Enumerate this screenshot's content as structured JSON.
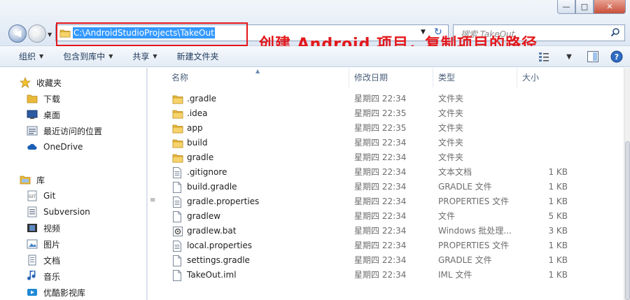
{
  "window": {
    "minimize_glyph": "—",
    "maximize_glyph": "□",
    "close_glyph": "✕"
  },
  "address": {
    "path": "C:\\AndroidStudioProjects\\TakeOut",
    "dropdown_glyph": "▼",
    "refresh_glyph": "↻"
  },
  "search": {
    "placeholder": "搜索 TakeOut"
  },
  "annotation": {
    "text": "创建 Android 项目，复制项目的路径",
    "color": "#e3171b"
  },
  "toolbar": {
    "organize": "组织",
    "include_in_library": "包含到库中",
    "share": "共享",
    "new_folder": "新建文件夹",
    "caret": "▼"
  },
  "sidebar": {
    "favorites_label": "收藏夹",
    "favorites": [
      {
        "label": "下载",
        "icon": "folder-icon"
      },
      {
        "label": "桌面",
        "icon": "desktop-icon"
      },
      {
        "label": "最近访问的位置",
        "icon": "recent-places-icon"
      },
      {
        "label": "OneDrive",
        "icon": "cloud-icon"
      }
    ],
    "library_label": "库",
    "libraries": [
      {
        "label": "Git",
        "icon": "git-library-icon"
      },
      {
        "label": "Subversion",
        "icon": "svn-library-icon"
      },
      {
        "label": "视频",
        "icon": "video-icon"
      },
      {
        "label": "图片",
        "icon": "pictures-icon"
      },
      {
        "label": "文档",
        "icon": "documents-icon"
      },
      {
        "label": "音乐",
        "icon": "music-icon"
      },
      {
        "label": "优酷影视库",
        "icon": "youku-library-icon"
      }
    ]
  },
  "columns": {
    "name": "名称",
    "modified": "修改日期",
    "type": "类型",
    "size": "大小"
  },
  "files": [
    {
      "name": ".gradle",
      "date": "星期四 22:34",
      "type": "文件夹",
      "size": "",
      "icon": "folder"
    },
    {
      "name": ".idea",
      "date": "星期四 22:35",
      "type": "文件夹",
      "size": "",
      "icon": "folder"
    },
    {
      "name": "app",
      "date": "星期四 22:35",
      "type": "文件夹",
      "size": "",
      "icon": "folder"
    },
    {
      "name": "build",
      "date": "星期四 22:34",
      "type": "文件夹",
      "size": "",
      "icon": "folder"
    },
    {
      "name": "gradle",
      "date": "星期四 22:34",
      "type": "文件夹",
      "size": "",
      "icon": "folder"
    },
    {
      "name": ".gitignore",
      "date": "星期四 22:34",
      "type": "文本文档",
      "size": "1 KB",
      "icon": "text"
    },
    {
      "name": "build.gradle",
      "date": "星期四 22:34",
      "type": "GRADLE 文件",
      "size": "1 KB",
      "icon": "file"
    },
    {
      "name": "gradle.properties",
      "date": "星期四 22:34",
      "type": "PROPERTIES 文件",
      "size": "1 KB",
      "icon": "text"
    },
    {
      "name": "gradlew",
      "date": "星期四 22:34",
      "type": "文件",
      "size": "5 KB",
      "icon": "file"
    },
    {
      "name": "gradlew.bat",
      "date": "星期四 22:34",
      "type": "Windows 批处理...",
      "size": "3 KB",
      "icon": "bat"
    },
    {
      "name": "local.properties",
      "date": "星期四 22:34",
      "type": "PROPERTIES 文件",
      "size": "1 KB",
      "icon": "text"
    },
    {
      "name": "settings.gradle",
      "date": "星期四 22:34",
      "type": "GRADLE 文件",
      "size": "1 KB",
      "icon": "file"
    },
    {
      "name": "TakeOut.iml",
      "date": "星期四 22:34",
      "type": "IML 文件",
      "size": "1 KB",
      "icon": "file"
    }
  ]
}
